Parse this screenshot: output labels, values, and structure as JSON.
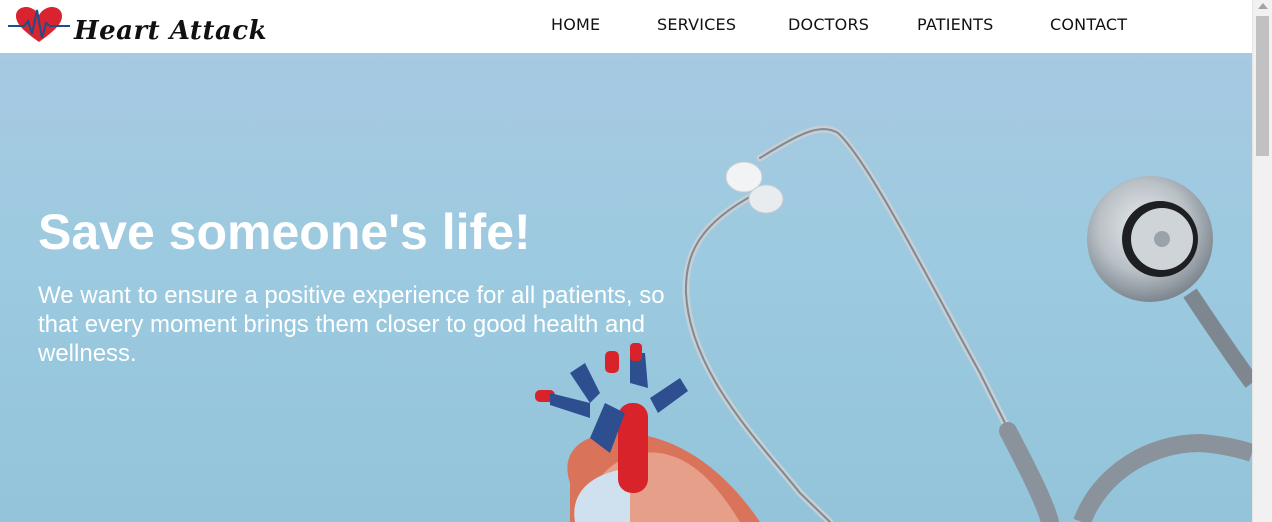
{
  "brand": {
    "name": "Heart Attack",
    "accent": "#d9232e"
  },
  "nav": [
    {
      "label": "HOME"
    },
    {
      "label": "SERVICES"
    },
    {
      "label": "DOCTORS"
    },
    {
      "label": "PATIENTS"
    },
    {
      "label": "CONTACT"
    }
  ],
  "hero": {
    "title": "Save someone's life!",
    "text": "We want to ensure a positive experience for all patients, so that every moment brings them closer to good health and wellness."
  },
  "colors": {
    "hero_background": "#9ccae0",
    "text": "#ffffff"
  }
}
